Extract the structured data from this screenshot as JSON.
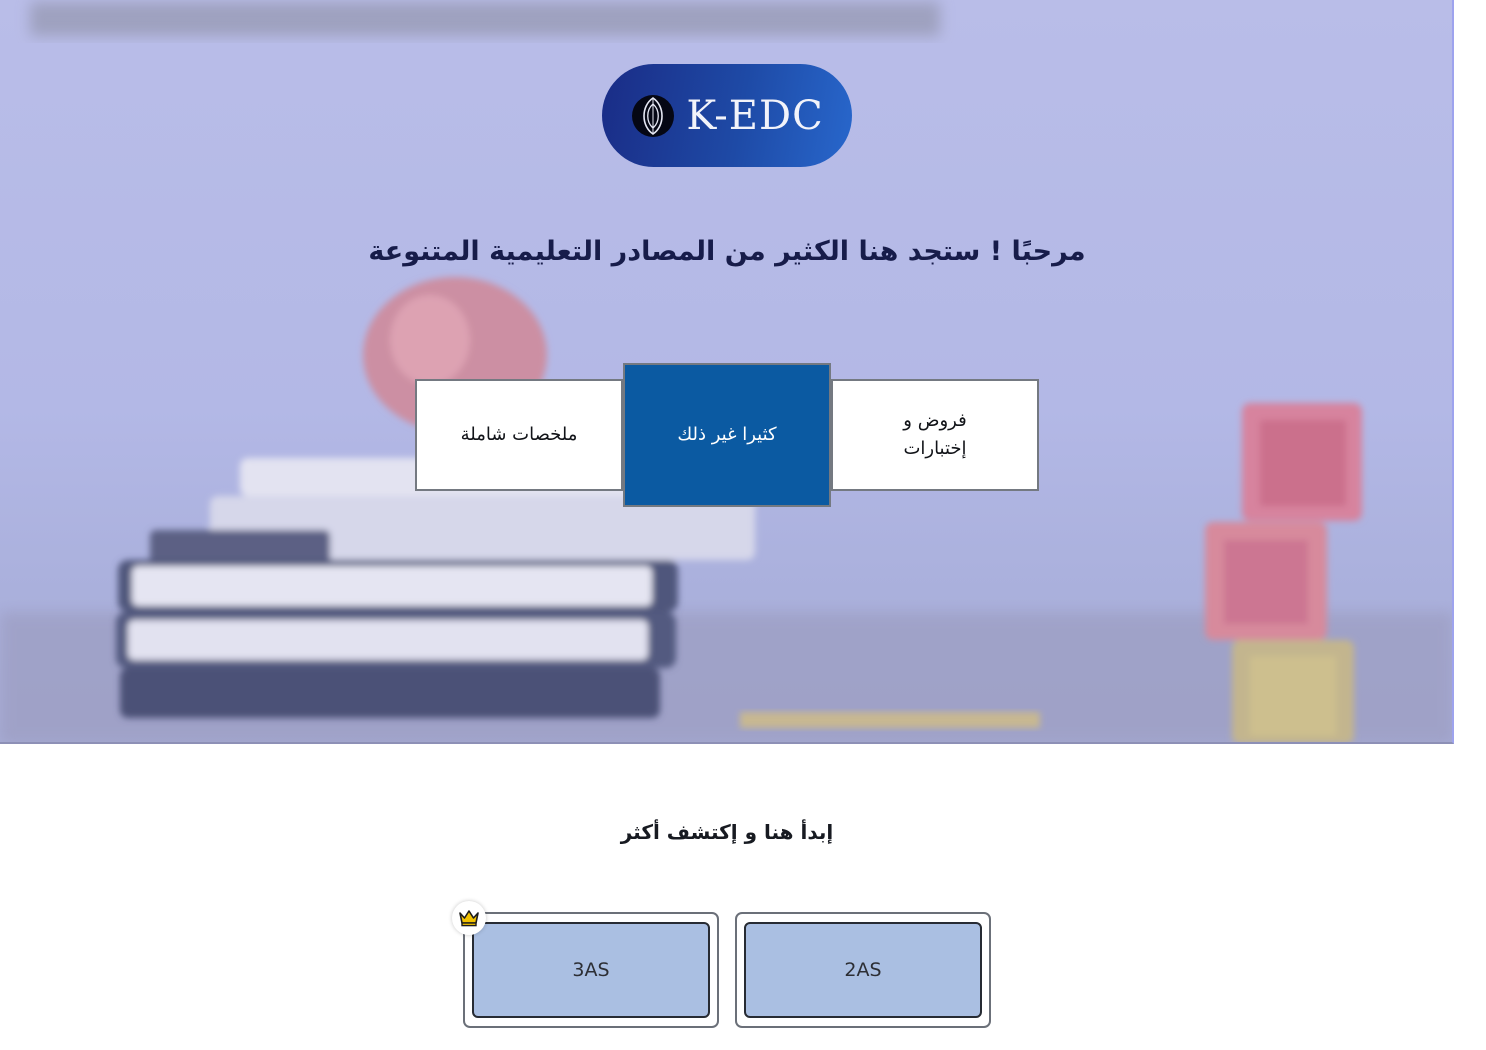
{
  "brand": {
    "name": "K-EDC",
    "logo_icon": "kedc-emblem-icon"
  },
  "hero": {
    "welcome": "مرحبًا ! ستجد هنا الكثير من المصادر التعليمية المتنوعة",
    "cards": [
      {
        "label": "فروض و إختبارات"
      },
      {
        "label": "كثيرا غير ذلك"
      },
      {
        "label": "ملخصات شاملة"
      }
    ]
  },
  "levels": {
    "heading": "إبدأ هنا و إكتشف أكثر",
    "items": [
      {
        "label": "2AS"
      },
      {
        "label": "3AS",
        "badge_icon": "crown-icon"
      }
    ]
  },
  "colors": {
    "hero_tint": "#b3b8e6",
    "logo_pill": "#1e4aa6",
    "card_active": "#0b5aa2",
    "level_button": "#aabfe2",
    "crown": "#f2c200"
  }
}
